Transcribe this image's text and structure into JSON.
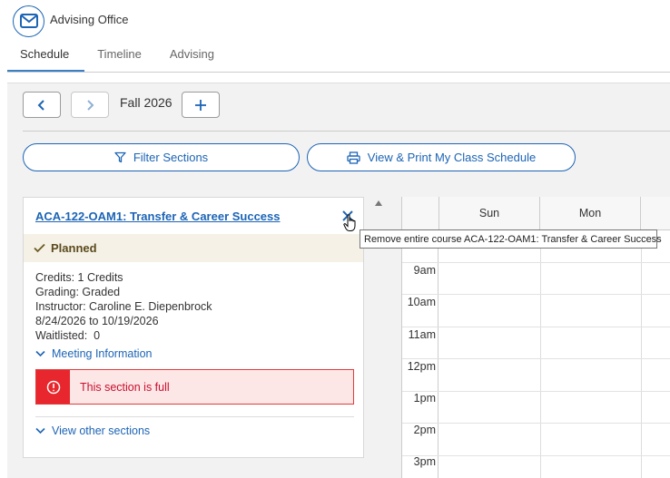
{
  "header": {
    "title": "Advising Office",
    "icon": "mail-icon"
  },
  "tabs": [
    {
      "label": "Schedule",
      "active": true
    },
    {
      "label": "Timeline",
      "active": false
    },
    {
      "label": "Advising",
      "active": false
    }
  ],
  "term_nav": {
    "term": "Fall 2026",
    "prev_icon": "chevron-left-icon",
    "next_icon": "chevron-right-icon",
    "add_icon": "plus-icon"
  },
  "actions": {
    "filter_label": "Filter Sections",
    "print_label": "View & Print My Class Schedule"
  },
  "course": {
    "title": "ACA-122-OAM1: Transfer & Career Success",
    "status": "Planned",
    "credits": "Credits: 1 Credits",
    "grading": "Grading: Graded",
    "instructor": "Instructor: Caroline E. Diepenbrock",
    "dates": "8/24/2026 to 10/19/2026",
    "waitlisted": "Waitlisted:  0",
    "meeting_link": "Meeting Information",
    "alert": "This section is full",
    "other_sections_link": "View other sections"
  },
  "tooltip": "Remove entire course ACA-122-OAM1: Transfer & Career Success",
  "calendar": {
    "days": [
      "Sun",
      "Mon"
    ],
    "times": [
      "9am",
      "10am",
      "11am",
      "12pm",
      "1pm",
      "2pm",
      "3pm"
    ]
  },
  "colors": {
    "accent": "#1c64b5",
    "alert_red": "#e8262d",
    "planned_bg": "#f5f1e6"
  }
}
